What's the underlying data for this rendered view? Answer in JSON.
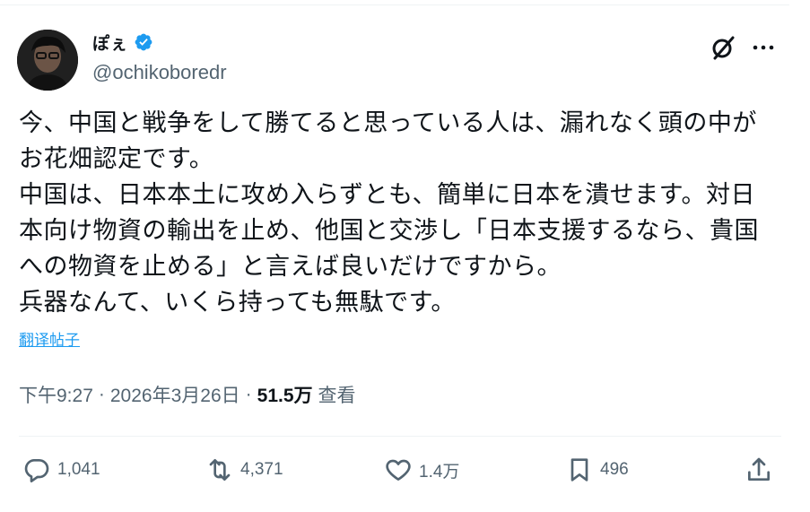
{
  "author": {
    "display_name": "ぽぇ",
    "handle": "@ochikoboredr",
    "verified": true
  },
  "tweet": {
    "text": "今、中国と戦争をして勝てると思っている人は、漏れなく頭の中がお花畑認定です。\n中国は、日本本土に攻め入らずとも、簡単に日本を潰せます。対日本向け物資の輸出を止め、他国と交渉し「日本支援するなら、貴国への物資を止める」と言えば良いだけですから。\n兵器なんて、いくら持っても無駄です。",
    "translate_label": "翻译帖子"
  },
  "meta": {
    "time": "下午9:27",
    "date": "2026年3月26日",
    "views_count": "51.5万",
    "views_label": "查看",
    "separator": "·"
  },
  "actions": {
    "replies": "1,041",
    "reposts": "4,371",
    "likes": "1.4万",
    "bookmarks": "496"
  },
  "colors": {
    "text": "#0f1419",
    "secondary": "#536471",
    "accent": "#1d9bf0"
  },
  "icons": [
    "verified-badge-icon",
    "grok-icon",
    "more-icon",
    "reply-icon",
    "repost-icon",
    "like-icon",
    "bookmark-icon",
    "share-icon"
  ]
}
